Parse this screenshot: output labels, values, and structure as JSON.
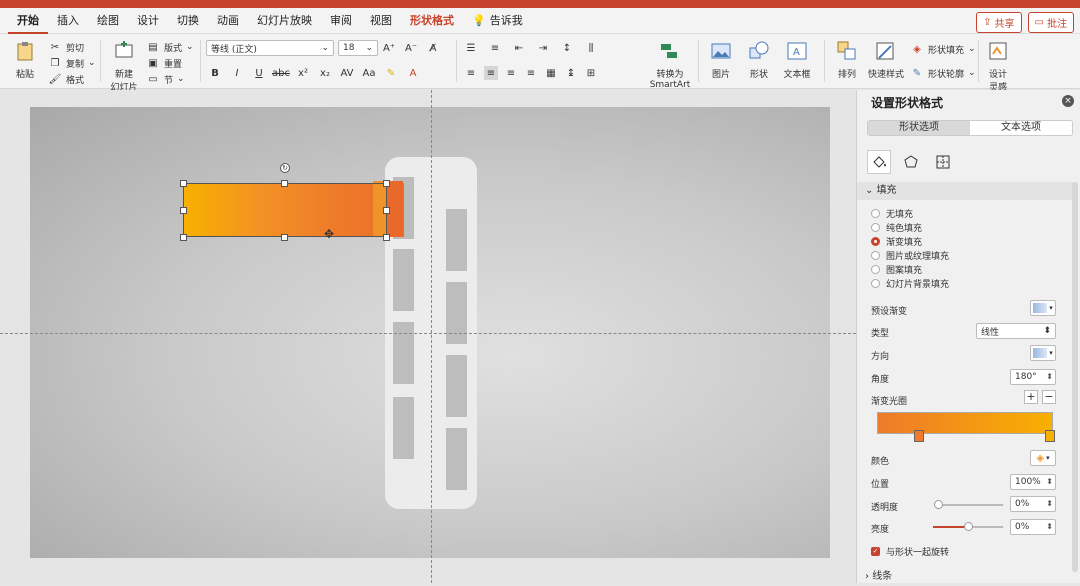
{
  "tabs": [
    "开始",
    "插入",
    "绘图",
    "设计",
    "切换",
    "动画",
    "幻灯片放映",
    "审阅",
    "视图",
    "形状格式"
  ],
  "tell_me": "告诉我",
  "share_label": "共享",
  "comment_label": "批注",
  "ribbon": {
    "paste": "粘贴",
    "cut": "剪切",
    "copy": "复制",
    "format": "格式",
    "new_slide_line1": "新建",
    "new_slide_line2": "幻灯片",
    "layout": "版式",
    "reset": "重置",
    "section": "节",
    "font_name": "等线 (正文)",
    "font_size": "18",
    "convert_line1": "转换为",
    "convert_line2": "SmartArt",
    "picture": "图片",
    "shape": "形状",
    "textbox": "文本框",
    "arrange": "排列",
    "quick_styles": "快速样式",
    "shape_fill": "形状填充",
    "shape_outline": "形状轮廓",
    "designer_line1": "设计",
    "designer_line2": "灵感"
  },
  "pane": {
    "title": "设置形状格式",
    "seg_shape": "形状选项",
    "seg_text": "文本选项",
    "fill_section": "填充",
    "fill_options": [
      "无填充",
      "纯色填充",
      "渐变填充",
      "图片或纹理填充",
      "图案填充",
      "幻灯片背景填充"
    ],
    "selected_fill_index": 2,
    "preset_label": "预设渐变",
    "type_label": "类型",
    "type_value": "线性",
    "direction_label": "方向",
    "angle_label": "角度",
    "angle_value": "180°",
    "stops_label": "渐变光圈",
    "color_label": "颜色",
    "position_label": "位置",
    "position_value": "100%",
    "transparency_label": "透明度",
    "transparency_value": "0%",
    "brightness_label": "亮度",
    "brightness_value": "0%",
    "rotate_label": "与形状一起旋转",
    "line_section": "线条"
  },
  "colors": {
    "accent": "#c8432d",
    "gradient_start": "#f8b000",
    "gradient_end": "#eb6f2b"
  }
}
